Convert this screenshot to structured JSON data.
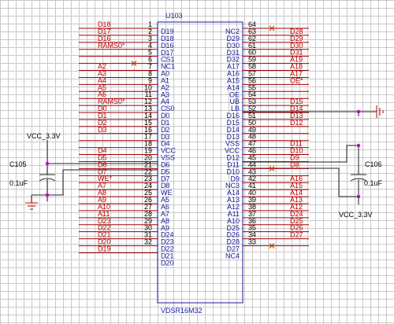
{
  "colors": {
    "net_label": "#c00000",
    "pin_name": "#1a1a9a",
    "pin_number": "#000000",
    "chip_outline": "#1a1a9a",
    "wire": "#a00000",
    "ground_symbol": "#c00000",
    "junction": "#c000c0"
  },
  "chip": {
    "ref": "U103",
    "part": "VDSR16M32"
  },
  "left_pins": [
    {
      "num": "1",
      "name": "D19",
      "net": "D18"
    },
    {
      "num": "2",
      "name": "D18",
      "net": "D17"
    },
    {
      "num": "3",
      "name": "D16",
      "net": "D16"
    },
    {
      "num": "4",
      "name": "D17",
      "net": "RAMS0*"
    },
    {
      "num": "5",
      "name": "CS1",
      "net": ""
    },
    {
      "num": "6",
      "name": "NC1",
      "net": ""
    },
    {
      "num": "7",
      "name": "A0",
      "net": "A2"
    },
    {
      "num": "8",
      "name": "A1",
      "net": "A3"
    },
    {
      "num": "9",
      "name": "A2",
      "net": "A4"
    },
    {
      "num": "10",
      "name": "A3",
      "net": "A5"
    },
    {
      "num": "11",
      "name": "A4",
      "net": "A6"
    },
    {
      "num": "12",
      "name": "CS0",
      "net": "RAMS0*"
    },
    {
      "num": "13",
      "name": "D0",
      "net": "D0"
    },
    {
      "num": "14",
      "name": "D1",
      "net": "D1"
    },
    {
      "num": "15",
      "name": "D2",
      "net": "D2"
    },
    {
      "num": "16",
      "name": "D3",
      "net": "D3"
    },
    {
      "num": "17",
      "name": "D4",
      "net": ""
    },
    {
      "num": "18",
      "name": "VCC",
      "net": ""
    },
    {
      "num": "19",
      "name": "VSS",
      "net": "D4"
    },
    {
      "num": "20",
      "name": "D6",
      "net": "D5"
    },
    {
      "num": "21",
      "name": "D5",
      "net": "D6"
    },
    {
      "num": "22",
      "name": "D7",
      "net": "D7"
    },
    {
      "num": "23",
      "name": "D8",
      "net": "WE*"
    },
    {
      "num": "24",
      "name": "WE",
      "net": "A7"
    },
    {
      "num": "25",
      "name": "A5",
      "net": "A8"
    },
    {
      "num": "26",
      "name": "A6",
      "net": "A9"
    },
    {
      "num": "27",
      "name": "A7",
      "net": "A10"
    },
    {
      "num": "28",
      "name": "A8",
      "net": "A11"
    },
    {
      "num": "29",
      "name": "A9",
      "net": "D23"
    },
    {
      "num": "30",
      "name": "D24",
      "net": "D22"
    },
    {
      "num": "31",
      "name": "D23",
      "net": "D21"
    },
    {
      "num": "32",
      "name": "D22",
      "net": "D20"
    },
    {
      "num": "",
      "name": "D21",
      "net": "D19"
    },
    {
      "num": "",
      "name": "D20",
      "net": ""
    }
  ],
  "right_pins": [
    {
      "num": "64",
      "name": "NC2",
      "net": ""
    },
    {
      "num": "63",
      "name": "D29",
      "net": "D28"
    },
    {
      "num": "62",
      "name": "D30",
      "net": "D29"
    },
    {
      "num": "61",
      "name": "D31",
      "net": "D30"
    },
    {
      "num": "60",
      "name": "D32",
      "net": "D31"
    },
    {
      "num": "59",
      "name": "A17",
      "net": "A19"
    },
    {
      "num": "58",
      "name": "A16",
      "net": "A18"
    },
    {
      "num": "57",
      "name": "A15",
      "net": "A17"
    },
    {
      "num": "56",
      "name": "A14",
      "net": "OE*"
    },
    {
      "num": "55",
      "name": "OE",
      "net": ""
    },
    {
      "num": "54",
      "name": "UB",
      "net": ""
    },
    {
      "num": "53",
      "name": "LB",
      "net": "D15"
    },
    {
      "num": "52",
      "name": "D16",
      "net": "D14"
    },
    {
      "num": "51",
      "name": "D15",
      "net": "D13"
    },
    {
      "num": "50",
      "name": "D14",
      "net": "D12"
    },
    {
      "num": "49",
      "name": "D13",
      "net": ""
    },
    {
      "num": "48",
      "name": "VSS",
      "net": ""
    },
    {
      "num": "47",
      "name": "VCC",
      "net": "D11"
    },
    {
      "num": "46",
      "name": "D12",
      "net": "D10"
    },
    {
      "num": "45",
      "name": "D11",
      "net": "D9"
    },
    {
      "num": "44",
      "name": "D10",
      "net": "D8"
    },
    {
      "num": "43",
      "name": "D9",
      "net": ""
    },
    {
      "num": "42",
      "name": "NC3",
      "net": "A16"
    },
    {
      "num": "41",
      "name": "A14",
      "net": "A15"
    },
    {
      "num": "40",
      "name": "A13",
      "net": "A14"
    },
    {
      "num": "39",
      "name": "A12",
      "net": "A13"
    },
    {
      "num": "38",
      "name": "A11",
      "net": "A12"
    },
    {
      "num": "37",
      "name": "A10",
      "net": "D24"
    },
    {
      "num": "36",
      "name": "D25",
      "net": "D25"
    },
    {
      "num": "35",
      "name": "D26",
      "net": "D26"
    },
    {
      "num": "34",
      "name": "D28",
      "net": "D27"
    },
    {
      "num": "33",
      "name": "D27",
      "net": ""
    },
    {
      "num": "",
      "name": "NC4",
      "net": ""
    }
  ],
  "no_connect": {
    "left_indices": [
      5
    ],
    "right_indices": [
      0,
      20,
      31
    ]
  },
  "caps": {
    "left": {
      "ref": "C105",
      "value": "0.1uF",
      "supply": "VCC_3.3V"
    },
    "right": {
      "ref": "C106",
      "value": "0.1uF",
      "supply": "VCC_3.3V"
    }
  }
}
